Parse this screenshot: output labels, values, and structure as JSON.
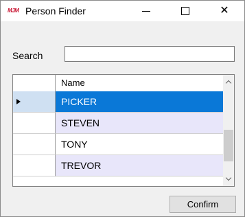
{
  "window": {
    "logo_text": "MJM",
    "title": "Person Finder",
    "controls": {
      "close_glyph": "✕"
    }
  },
  "search": {
    "label": "Search",
    "value": "",
    "placeholder": ""
  },
  "grid": {
    "columns": [
      "Name"
    ],
    "rows": [
      {
        "name": "PICKER",
        "selected": true,
        "current": true
      },
      {
        "name": "STEVEN",
        "selected": false,
        "current": false
      },
      {
        "name": "TONY",
        "selected": false,
        "current": false
      },
      {
        "name": "TREVOR",
        "selected": false,
        "current": false
      }
    ]
  },
  "actions": {
    "confirm_label": "Confirm"
  },
  "colors": {
    "selection": "#0a78d7",
    "alt_row": "#e8e6fa",
    "row_header_selected": "#cfe0f2",
    "logo": "#c8102e"
  }
}
